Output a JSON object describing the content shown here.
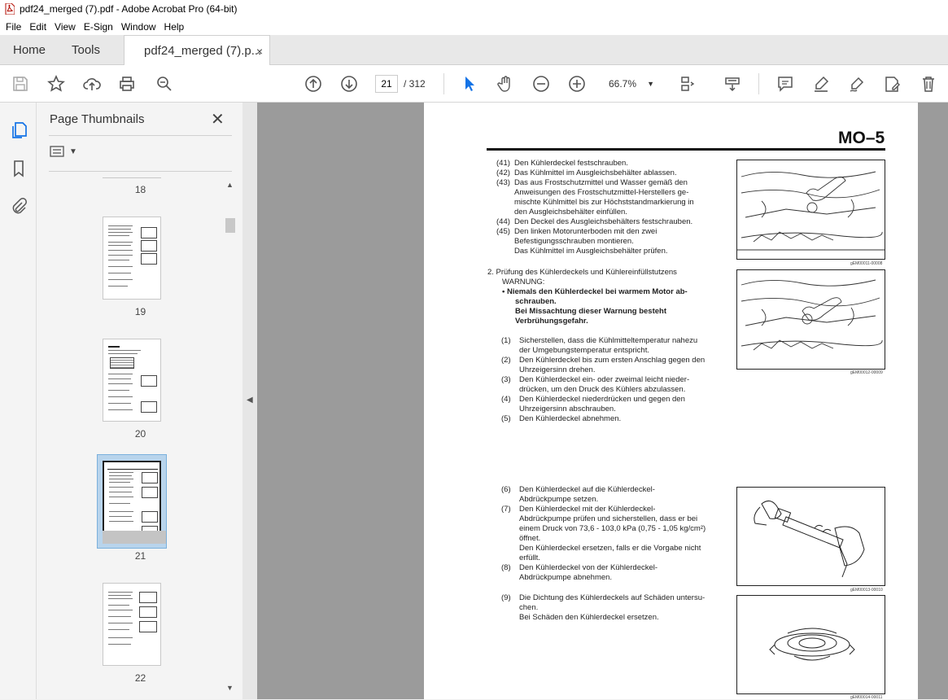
{
  "window": {
    "title": "pdf24_merged (7).pdf - Adobe Acrobat Pro (64-bit)"
  },
  "menu": [
    "File",
    "Edit",
    "View",
    "E-Sign",
    "Window",
    "Help"
  ],
  "tabs": {
    "home": "Home",
    "tools": "Tools",
    "doc": "pdf24_merged (7).p...",
    "close": "×"
  },
  "toolbar": {
    "page_current": "21",
    "page_total": "/  312",
    "zoom": "66.7%"
  },
  "panel": {
    "title": "Page Thumbnails",
    "close": "✕",
    "thumbs": [
      {
        "label": "18"
      },
      {
        "label": "19"
      },
      {
        "label": "20"
      },
      {
        "label": "21"
      },
      {
        "label": "22"
      }
    ]
  },
  "doc": {
    "header": "MO–5",
    "s1": [
      {
        "n": "(41)",
        "t": "Den Kühlerdeckel festschrauben."
      },
      {
        "n": "(42)",
        "t": "Das Kühlmittel im Ausgleichsbehälter ablassen."
      },
      {
        "n": "(43)",
        "t": "Das aus Frostschutzmittel und Wasser gemäß den"
      },
      {
        "n": "",
        "t": "Anweisungen des Frostschutzmittel-Herstellers ge-"
      },
      {
        "n": "",
        "t": "mischte Kühlmittel bis zur Höchststandmarkierung in"
      },
      {
        "n": "",
        "t": "den Ausgleichsbehälter einfüllen."
      },
      {
        "n": "(44)",
        "t": "Den Deckel des Ausgleichsbehälters festschrauben."
      },
      {
        "n": "(45)",
        "t": "Den linken Motorunterboden mit den zwei"
      },
      {
        "n": "",
        "t": "Befestigungsschrauben montieren."
      },
      {
        "n": "",
        "t": "Das Kühlmittel im Ausgleichsbehälter prüfen."
      }
    ],
    "s2_heading": "2.   Prüfung des Kühlerdeckels und Kühlereinfüllstutzens",
    "warn": "WARNUNG:",
    "warn_lines": [
      "•   Niemals den Kühlerdeckel bei warmem Motor ab-",
      "schrauben.",
      "Bei Missachtung dieser Warnung besteht",
      "Verbrühungsgefahr."
    ],
    "s3": [
      {
        "n": "(1)",
        "t": "Sicherstellen, dass die Kühlmitteltemperatur nahezu"
      },
      {
        "n": "",
        "t": "der Umgebungstemperatur entspricht."
      },
      {
        "n": "(2)",
        "t": "Den Kühlerdeckel bis zum ersten Anschlag gegen den"
      },
      {
        "n": "",
        "t": "Uhrzeigersinn drehen."
      },
      {
        "n": "(3)",
        "t": "Den Kühlerdeckel ein- oder zweimal leicht nieder-"
      },
      {
        "n": "",
        "t": "drücken, um den Druck des Kühlers abzulassen."
      },
      {
        "n": "(4)",
        "t": "Den Kühlerdeckel niederdrücken und gegen den"
      },
      {
        "n": "",
        "t": "Uhrzeigersinn abschrauben."
      },
      {
        "n": "(5)",
        "t": "Den Kühlerdeckel abnehmen."
      }
    ],
    "s4": [
      {
        "n": "(6)",
        "t": "Den Kühlerdeckel auf die Kühlerdeckel-"
      },
      {
        "n": "",
        "t": "Abdrückpumpe setzen."
      },
      {
        "n": "(7)",
        "t": "Den Kühlerdeckel mit der Kühlerdeckel-"
      },
      {
        "n": "",
        "t": "Abdrückpumpe prüfen und sicherstellen, dass er bei"
      },
      {
        "n": "",
        "t": "einem Druck von 73,6 - 103,0 kPa (0,75 - 1,05 kg/cm²)"
      },
      {
        "n": "",
        "t": "öffnet."
      },
      {
        "n": "",
        "t": "Den Kühlerdeckel ersetzen, falls er die Vorgabe nicht"
      },
      {
        "n": "",
        "t": "erfüllt."
      },
      {
        "n": "(8)",
        "t": "Den Kühlerdeckel von der Kühlerdeckel-"
      },
      {
        "n": "",
        "t": "Abdrückpumpe abnehmen."
      }
    ],
    "s5": [
      {
        "n": "(9)",
        "t": "Die Dichtung des Kühlerdeckels auf Schäden untersu-"
      },
      {
        "n": "",
        "t": "chen."
      },
      {
        "n": "",
        "t": "Bei Schäden den Kühlerdeckel ersetzen."
      }
    ],
    "captions": [
      "gEM00011-00008",
      "gEM00012-00009",
      "gEM00013-00010",
      "gEM00014-00011"
    ]
  }
}
